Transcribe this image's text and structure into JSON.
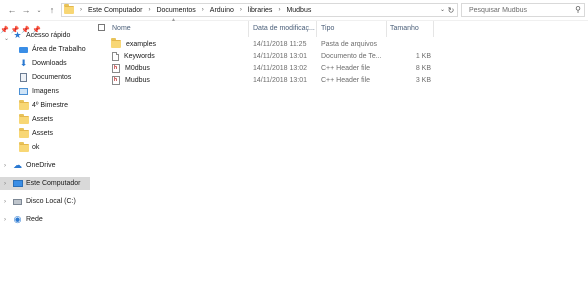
{
  "address": {
    "crumbs": [
      "Este Computador",
      "Documentos",
      "Arduino",
      "libraries",
      "Mudbus"
    ],
    "search_placeholder": "Pesquisar Mudbus"
  },
  "nav": {
    "quick_access": "Acesso rápido",
    "items": [
      {
        "label": "Área de Trabalho",
        "icon": "desktop-icon",
        "pinned": true
      },
      {
        "label": "Downloads",
        "icon": "download-icon",
        "pinned": true
      },
      {
        "label": "Documentos",
        "icon": "documents-icon",
        "pinned": true
      },
      {
        "label": "Imagens",
        "icon": "pictures-icon",
        "pinned": true
      },
      {
        "label": "4º Bimestre",
        "icon": "folder-icon",
        "pinned": false
      },
      {
        "label": "Assets",
        "icon": "folder-icon",
        "pinned": false
      },
      {
        "label": "Assets",
        "icon": "folder-icon",
        "pinned": false
      },
      {
        "label": "ok",
        "icon": "folder-icon",
        "pinned": false
      }
    ],
    "onedrive": "OneDrive",
    "this_pc": "Este Computador",
    "local_disk": "Disco Local (C:)",
    "network": "Rede"
  },
  "columns": {
    "name": "Nome",
    "date": "Data de modificaç...",
    "type": "Tipo",
    "size": "Tamanho"
  },
  "files": [
    {
      "name": "examples",
      "date": "14/11/2018 11:25",
      "type": "Pasta de arquivos",
      "size": "",
      "icon": "folder-icon"
    },
    {
      "name": "Keywords",
      "date": "14/11/2018 13:01",
      "type": "Documento de Te...",
      "size": "1 KB",
      "icon": "text-document-icon"
    },
    {
      "name": "M0dbus",
      "date": "14/11/2018 13:02",
      "type": "C++ Header file",
      "size": "8 KB",
      "icon": "cpp-header-icon"
    },
    {
      "name": "Mudbus",
      "date": "14/11/2018 13:01",
      "type": "C++ Header file",
      "size": "3 KB",
      "icon": "cpp-header-icon"
    }
  ],
  "colors": {
    "selection": "#d9d9d9",
    "folder": "#f8d775",
    "header_text": "#4c607a",
    "quick_access_star": "#2b79d1"
  }
}
